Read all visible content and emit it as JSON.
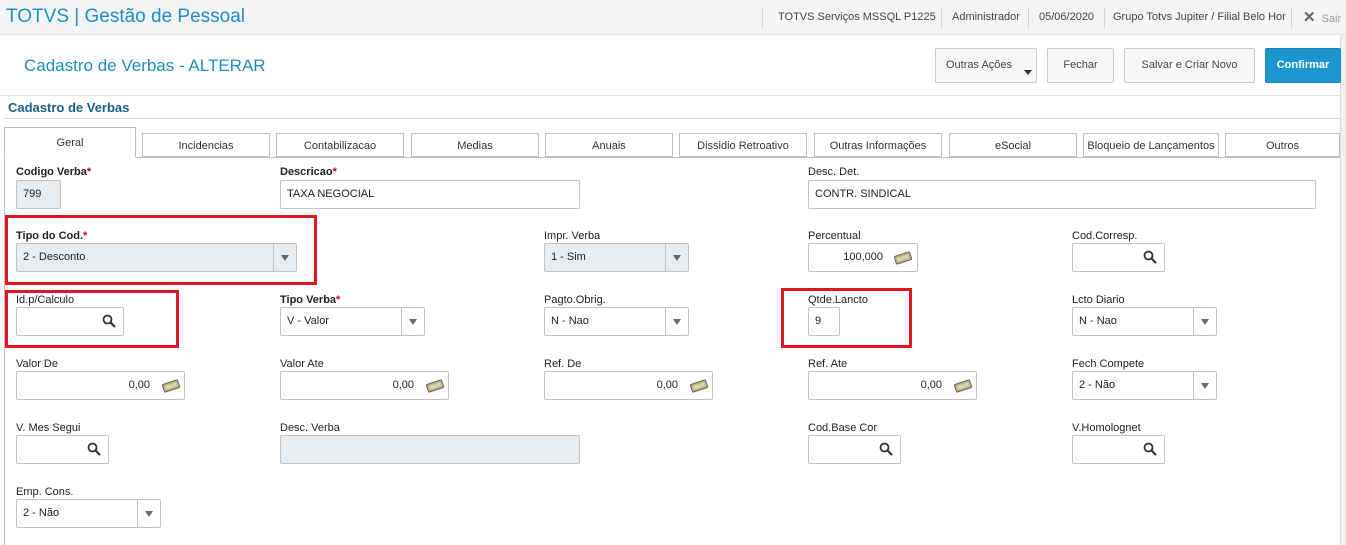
{
  "topbar": {
    "brand": "TOTVS | Gestão de Pessoal",
    "environment": "TOTVS Serviços MSSQL P1225",
    "user": "Administrador",
    "date": "05/06/2020",
    "company": "Grupo Totvs Jupiter / Filial Belo Hor",
    "exit": "Sair"
  },
  "header": {
    "title": "Cadastro de Verbas - ALTERAR",
    "buttons": {
      "more_actions": "Outras Ações",
      "close": "Fechar",
      "save_new": "Salvar e Criar Novo",
      "confirm": "Confirmar"
    }
  },
  "section_title": "Cadastro de Verbas",
  "tabs": [
    "Geral",
    "Incidencias",
    "Contabilizacao",
    "Medias",
    "Anuais",
    "Dissidio Retroativo",
    "Outras Informações",
    "eSocial",
    "Bloqueio de Lançamentos",
    "Outros"
  ],
  "fields": {
    "codigo_verba": {
      "label": "Codigo Verba",
      "value": "799"
    },
    "descricao": {
      "label": "Descricao",
      "value": "TAXA NEGOCIAL"
    },
    "desc_det": {
      "label": "Desc. Det.",
      "value": "CONTR. SINDICAL"
    },
    "tipo_cod": {
      "label": "Tipo do Cod.",
      "value": "2 - Desconto"
    },
    "impr_verba": {
      "label": "Impr. Verba",
      "value": "1 - Sim"
    },
    "percentual": {
      "label": "Percentual",
      "value": "100,000"
    },
    "cod_corresp": {
      "label": "Cod.Corresp.",
      "value": ""
    },
    "id_calculo": {
      "label": "Id.p/Calculo",
      "value": ""
    },
    "tipo_verba": {
      "label": "Tipo Verba",
      "value": "V - Valor"
    },
    "pagto_obrig": {
      "label": "Pagto.Obrig.",
      "value": "N - Nao"
    },
    "qtde_lancto": {
      "label": "Qtde.Lancto",
      "value": "9"
    },
    "lcto_diario": {
      "label": "Lcto Diario",
      "value": "N - Nao"
    },
    "valor_de": {
      "label": "Valor De",
      "value": "0,00"
    },
    "valor_ate": {
      "label": "Valor Ate",
      "value": "0,00"
    },
    "ref_de": {
      "label": "Ref. De",
      "value": "0,00"
    },
    "ref_ate": {
      "label": "Ref. Ate",
      "value": "0,00"
    },
    "fech_compete": {
      "label": "Fech Compete",
      "value": "2 - Não"
    },
    "v_mes_segui": {
      "label": "V. Mes Segui",
      "value": ""
    },
    "desc_verba": {
      "label": "Desc. Verba",
      "value": ""
    },
    "cod_base_cor": {
      "label": "Cod.Base Cor",
      "value": ""
    },
    "v_homolognet": {
      "label": "V.Homolognet",
      "value": ""
    },
    "emp_cons": {
      "label": "Emp. Cons.",
      "value": "2 - Não"
    }
  },
  "required_mark": "*",
  "colors": {
    "accent": "#1d8ec4",
    "primary_button": "#1d95cf",
    "highlight": "#e3151f",
    "required": "#d0021b"
  }
}
